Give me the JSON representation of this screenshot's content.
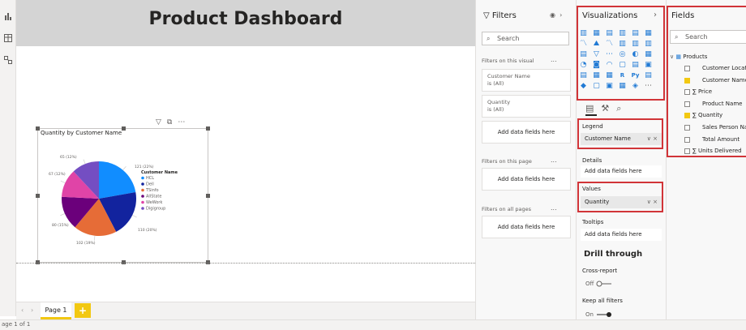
{
  "colors": {
    "accent_yellow": "#f2c811",
    "highlight_red": "#d13438",
    "viz_icon_blue": "#217ad4"
  },
  "report": {
    "title": "Product Dashboard",
    "page_tab": "Page 1",
    "add_page_icon": "plus-icon",
    "status": "age 1 of 1",
    "nav_prev": "‹",
    "nav_next": "›"
  },
  "visual": {
    "title": "Quantity by Customer Name",
    "toolbar_icons": [
      "filter-icon",
      "focus-mode-icon",
      "more-options-icon"
    ]
  },
  "chart_data": {
    "type": "pie",
    "title": "Quantity by Customer Name",
    "legend_title": "Customer Name",
    "legend_position": "right",
    "slices": [
      {
        "name": "HCL",
        "value": 121,
        "label": "121 (22%)",
        "color": "#118dff"
      },
      {
        "name": "Dell",
        "value": 110,
        "label": "110 (20%)",
        "color": "#12239e"
      },
      {
        "name": "TSinfo",
        "value": 102,
        "label": "102 (19%)",
        "color": "#e66c37"
      },
      {
        "name": "AllState",
        "value": 80,
        "label": "80 (15%)",
        "color": "#6b007b"
      },
      {
        "name": "WeWork",
        "value": 67,
        "label": "67 (12%)",
        "color": "#e044a7"
      },
      {
        "name": "Digigroup",
        "value": 65,
        "label": "65 (12%)",
        "color": "#744ec2"
      }
    ]
  },
  "filters": {
    "title": "Filters",
    "search_placeholder": "Search",
    "on_visual": "Filters on this visual",
    "card1_name": "Customer Name",
    "card1_value": "is (All)",
    "card2_name": "Quantity",
    "card2_value": "is (All)",
    "add_fields": "Add data fields here",
    "on_page": "Filters on this page",
    "on_all_pages": "Filters on all pages",
    "more": "..."
  },
  "visualizations": {
    "title": "Visualizations",
    "legend_label": "Legend",
    "legend_field": "Customer Name",
    "details_label": "Details",
    "details_empty": "Add data fields here",
    "values_label": "Values",
    "values_field": "Quantity",
    "tooltips_label": "Tooltips",
    "tooltips_empty": "Add data fields here",
    "drill_title": "Drill through",
    "cross_report": "Cross-report",
    "cross_report_state": "Off",
    "keep_filters": "Keep all filters",
    "keep_filters_state": "On",
    "field_controls": "∨ ×"
  },
  "fields": {
    "title": "Fields",
    "search_placeholder": "Search",
    "table_name": "Products",
    "items": [
      {
        "label": "Customer Location",
        "checked": false,
        "sigma": false
      },
      {
        "label": "Customer Name",
        "checked": true,
        "sigma": false
      },
      {
        "label": "Price",
        "checked": false,
        "sigma": true
      },
      {
        "label": "Product Name",
        "checked": false,
        "sigma": false
      },
      {
        "label": "Quantity",
        "checked": true,
        "sigma": true
      },
      {
        "label": "Sales Person Name",
        "checked": false,
        "sigma": false
      },
      {
        "label": "Total Amount",
        "checked": false,
        "sigma": false
      },
      {
        "label": "Units Delivered",
        "checked": false,
        "sigma": true
      }
    ]
  }
}
